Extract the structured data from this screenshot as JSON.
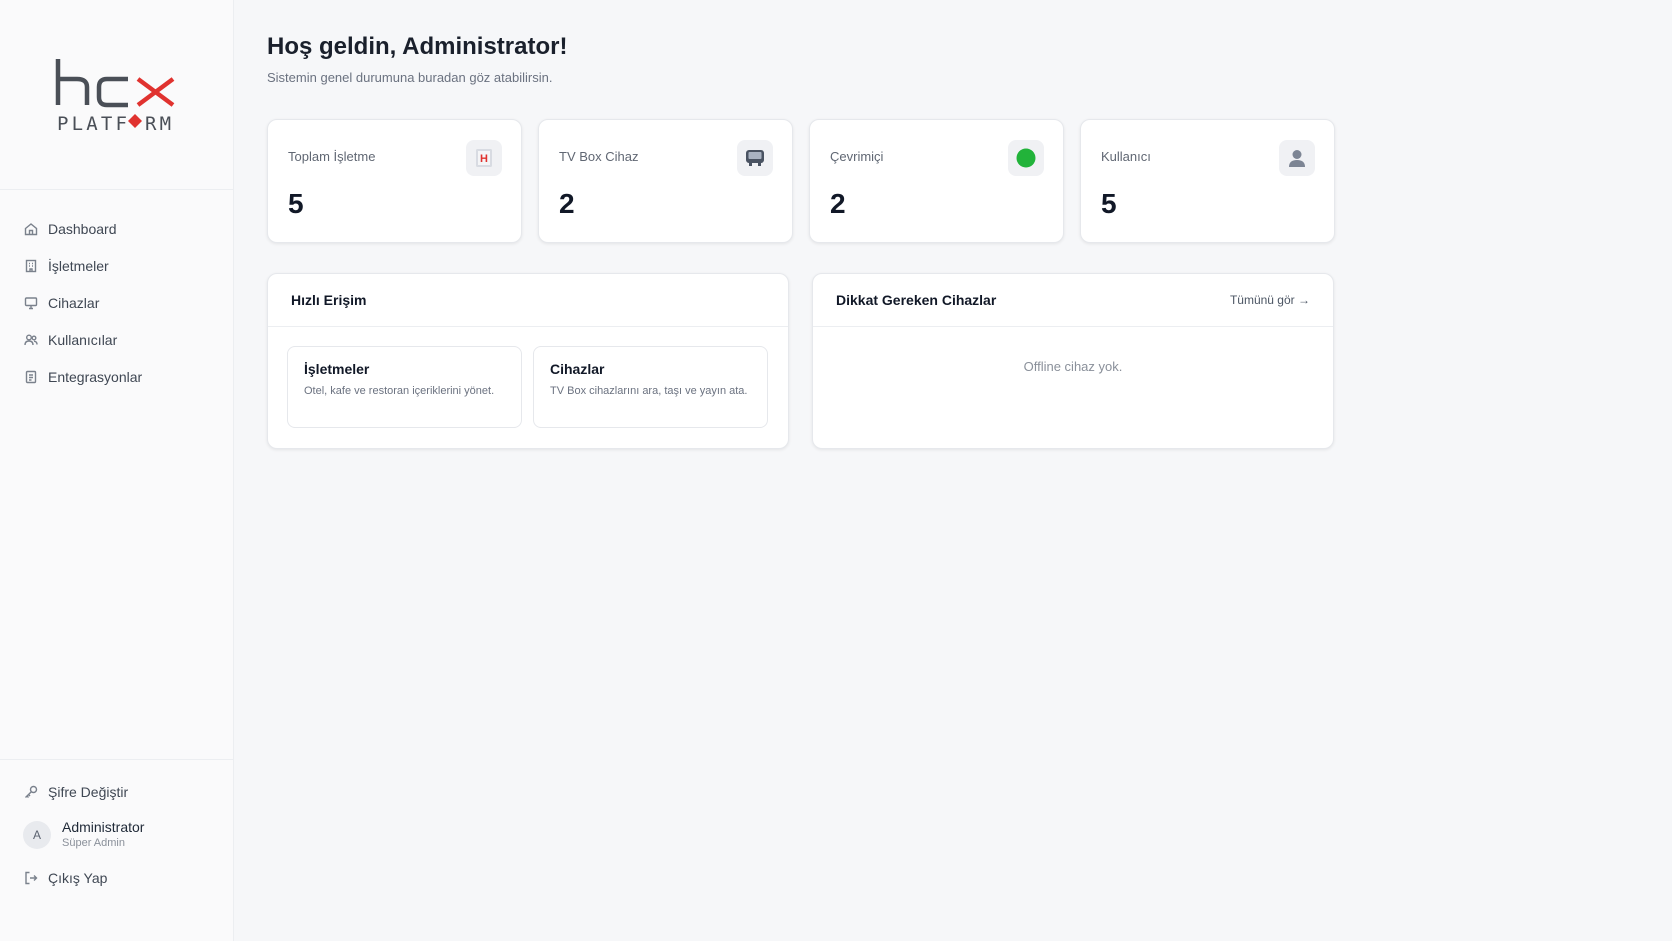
{
  "brand": {
    "logo_top": "hcx",
    "logo_bottom": "PLATFORM",
    "accent_color": "#e0322f"
  },
  "sidebar": {
    "items": [
      {
        "label": "Dashboard",
        "icon": "home-icon"
      },
      {
        "label": "İşletmeler",
        "icon": "building-icon"
      },
      {
        "label": "Cihazlar",
        "icon": "monitor-icon"
      },
      {
        "label": "Kullanıcılar",
        "icon": "users-icon"
      },
      {
        "label": "Entegrasyonlar",
        "icon": "document-icon"
      }
    ],
    "change_password": "Şifre Değiştir",
    "user": {
      "initial": "A",
      "name": "Administrator",
      "role": "Süper Admin"
    },
    "logout": "Çıkış Yap"
  },
  "header": {
    "title": "Hoş geldin, Administrator!",
    "subtitle": "Sistemin genel durumuna buradan göz atabilirsin."
  },
  "stats": [
    {
      "label": "Toplam İşletme",
      "value": "5",
      "icon": "hotel-icon"
    },
    {
      "label": "TV Box Cihaz",
      "value": "2",
      "icon": "tv-box-icon"
    },
    {
      "label": "Çevrimiçi",
      "value": "2",
      "icon": "online-status-icon",
      "color": "#22b33a"
    },
    {
      "label": "Kullanıcı",
      "value": "5",
      "icon": "user-icon"
    }
  ],
  "quick_access": {
    "title": "Hızlı Erişim",
    "cards": [
      {
        "title": "İşletmeler",
        "desc": "Otel, kafe ve restoran içeriklerini yönet."
      },
      {
        "title": "Cihazlar",
        "desc": "TV Box cihazlarını ara, taşı ve yayın ata."
      }
    ]
  },
  "attention": {
    "title": "Dikkat Gereken Cihazlar",
    "link": "Tümünü gör →",
    "empty": "Offline cihaz yok."
  }
}
